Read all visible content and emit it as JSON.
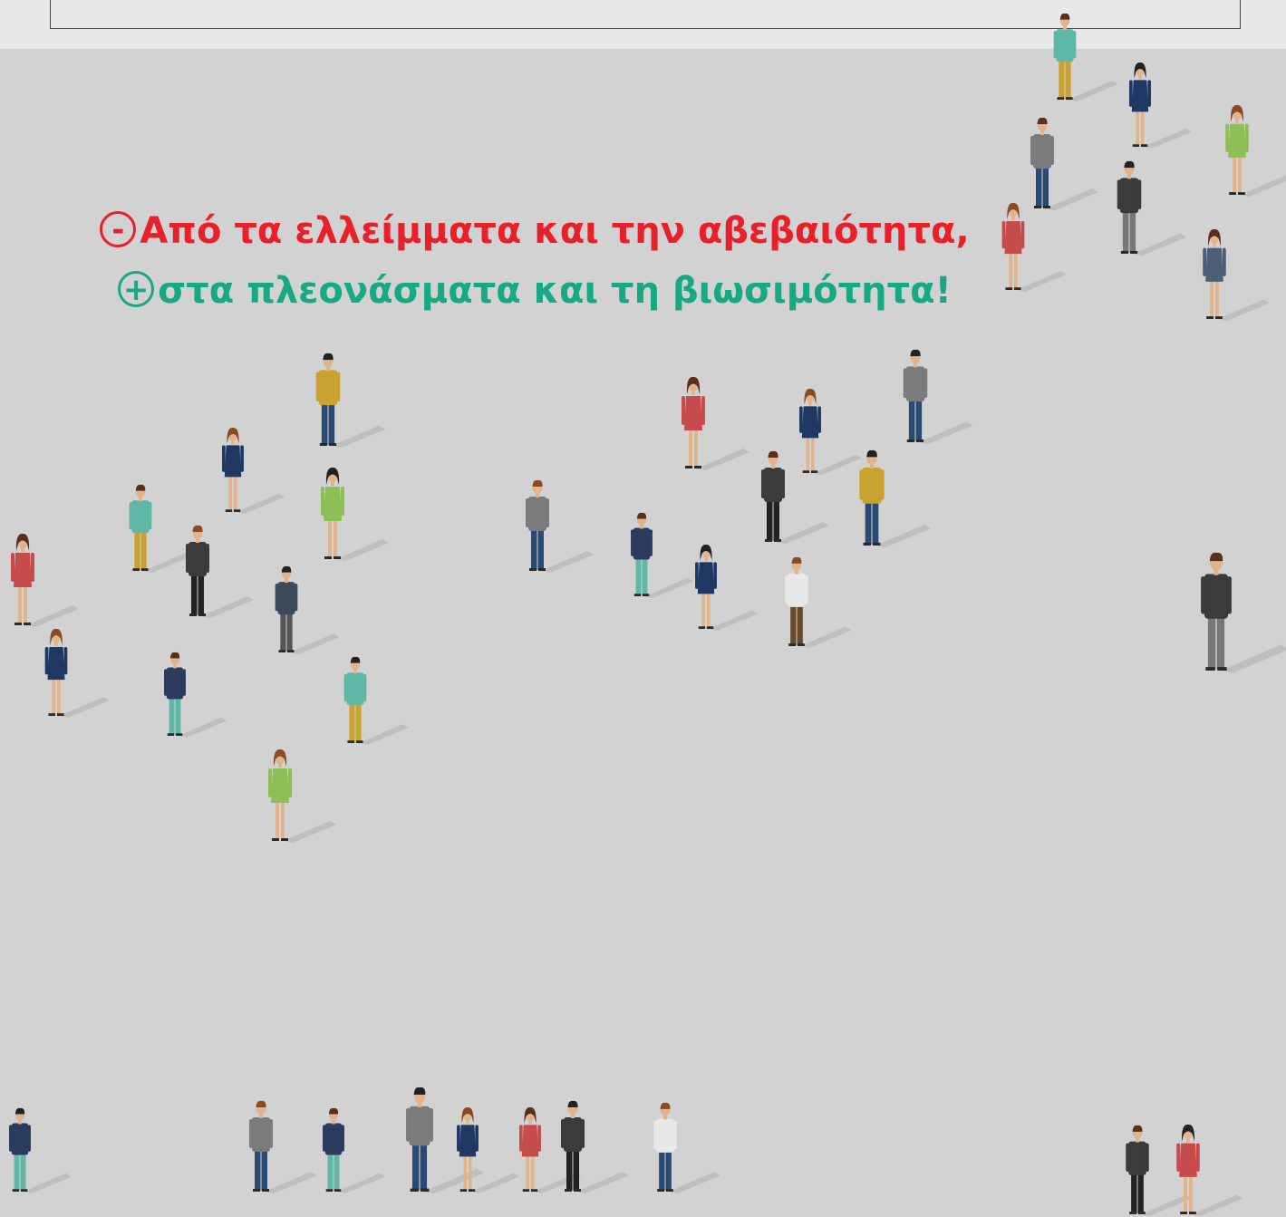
{
  "headline": {
    "line1": "Από τα ελλείμματα και την αβεβαιότητα,",
    "line2": "στα πλεονάσματα και τη βιωσιμότητα!",
    "minus_symbol": "-",
    "plus_symbol": "+"
  },
  "colors": {
    "background": "#d3d2d3",
    "top_band": "#e9e9e9",
    "negative": "#e8202a",
    "positive": "#17a983"
  },
  "illustration": "crowd-of-people-figures"
}
